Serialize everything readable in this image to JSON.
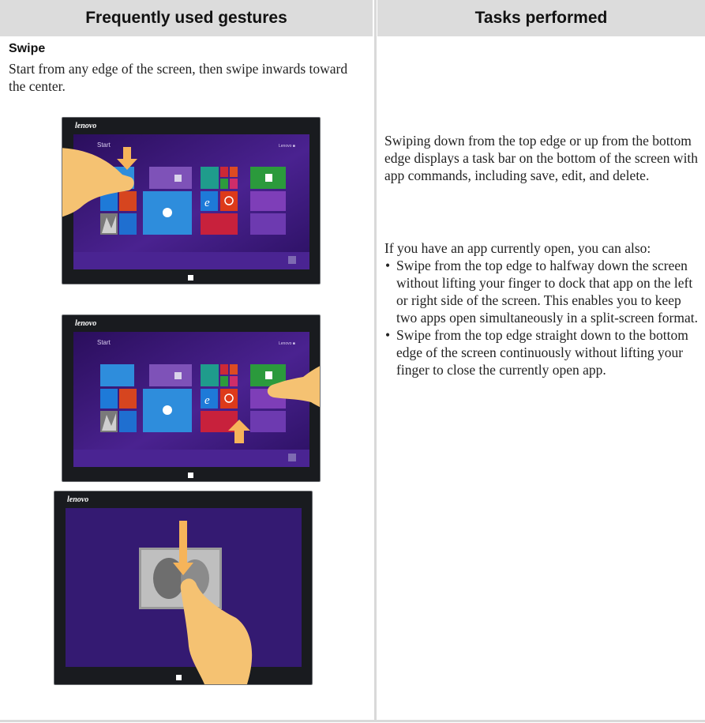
{
  "table": {
    "header_left": "Frequently used gestures",
    "header_right": "Tasks performed"
  },
  "gesture": {
    "title": "Swipe",
    "description": "Start from any edge of the screen, then swipe inwards toward the center."
  },
  "tasks": {
    "intro": "Swiping down from the top edge or up from the bottom edge displays a task bar on the bottom of the screen with app commands, including save, edit, and delete.",
    "open_app_lead": "If you have an app currently open, you can also:",
    "bullets": [
      "Swipe from the top edge to halfway down the screen without lifting your finger to dock that app on the left or right side of the screen. This enables you to keep two apps open simultaneously in a split-screen format.",
      "Swipe from the top edge straight down to the bottom edge of the screen continuously without lifting your finger to close the currently open app."
    ]
  },
  "illustrations": [
    {
      "brand": "lenovo",
      "screen_title": "Start",
      "gesture": "swipe down from top edge",
      "icons": [
        "hand-icon",
        "arrow-down-icon"
      ]
    },
    {
      "brand": "lenovo",
      "screen_title": "Start",
      "gesture": "swipe up from bottom edge",
      "icons": [
        "hand-icon",
        "arrow-up-icon"
      ]
    },
    {
      "brand": "lenovo",
      "gesture": "swipe from top edge to bottom edge to close app",
      "icons": [
        "hand-icon",
        "arrow-down-icon"
      ]
    }
  ],
  "colors": {
    "header_bg": "#dcdcdc",
    "start_screen_bg": "#3b1875",
    "hand": "#f5c272",
    "arrow": "#f6b45a"
  }
}
